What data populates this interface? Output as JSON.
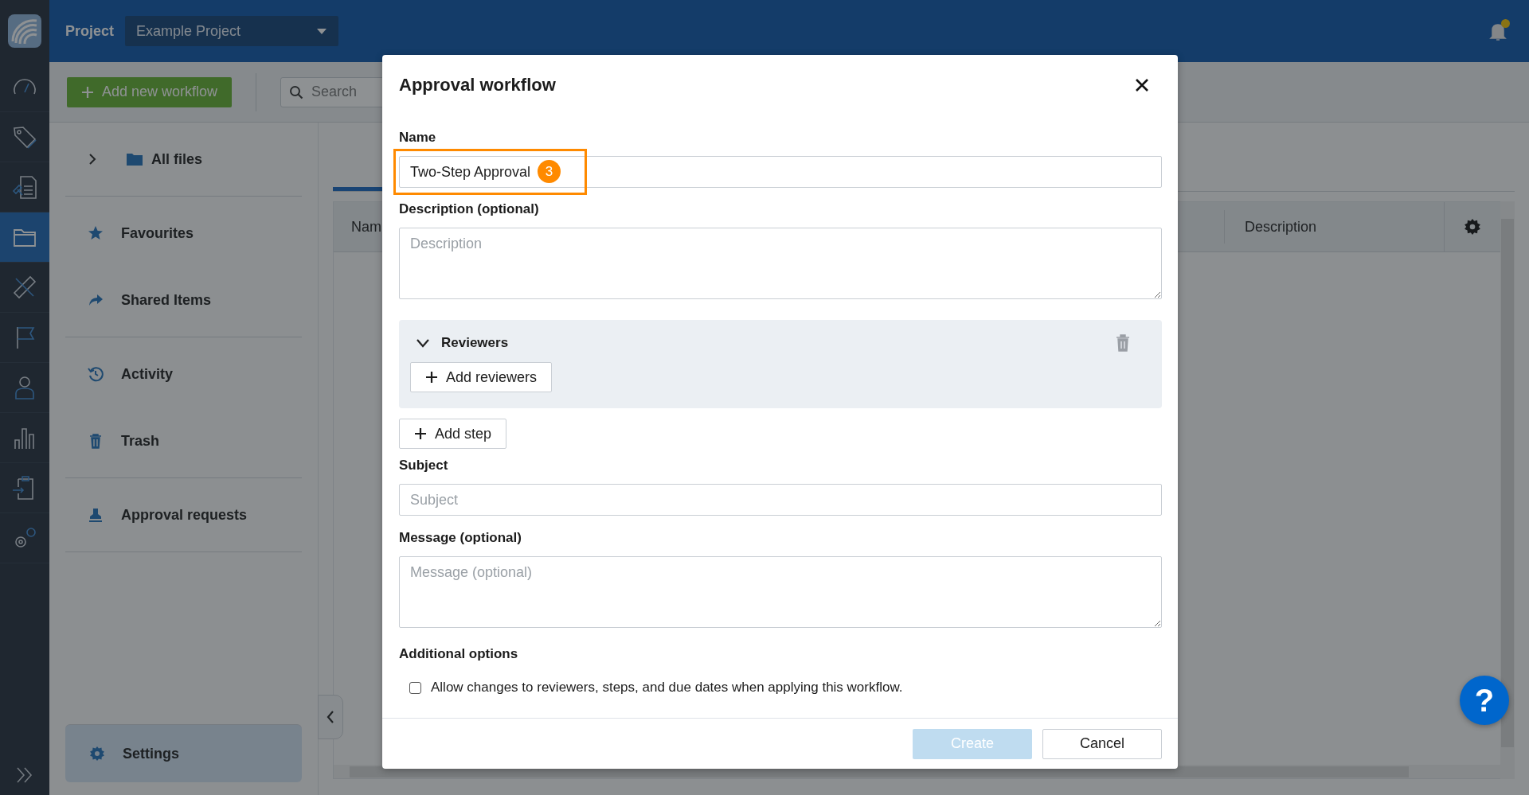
{
  "top_bar": {
    "project_label": "Project",
    "project_select": "Example Project",
    "notifications": {
      "unread": true
    }
  },
  "rail": [
    {
      "selected": false
    },
    {
      "selected": false
    },
    {
      "selected": false
    },
    {
      "selected": true
    },
    {
      "selected": false
    },
    {
      "selected": false
    },
    {
      "selected": false
    },
    {
      "selected": false
    },
    {
      "selected": false
    },
    {
      "selected": false
    }
  ],
  "toolbar": {
    "add_button": "Add new workflow",
    "search": {
      "placeholder": "Search"
    }
  },
  "nav": [
    [
      {
        "label": "All files",
        "expanded": false
      }
    ],
    [
      {
        "label": "Favourites"
      },
      {
        "label": "Shared Items"
      }
    ],
    [
      {
        "label": "Activity"
      },
      {
        "label": "Trash"
      }
    ],
    [
      {
        "label": "Approval requests"
      }
    ]
  ],
  "settings": {
    "label": "Settings",
    "selected": true
  },
  "table": {
    "columns": [
      "Nam",
      "Description"
    ]
  },
  "dialog": {
    "title": "Approval workflow",
    "name": {
      "label": "Name",
      "value": "Two-Step Approval"
    },
    "annotation": {
      "number": "3"
    },
    "description": {
      "label": "Description (optional)",
      "placeholder": "Description"
    },
    "steps": [
      {
        "title": "Reviewers",
        "expanded": true,
        "add_button": "Add reviewers"
      }
    ],
    "add_step": "Add step",
    "subject": {
      "label": "Subject",
      "placeholder": "Subject"
    },
    "message": {
      "label": "Message (optional)",
      "placeholder": "Message (optional)"
    },
    "options_title": "Additional options",
    "options": [
      {
        "label": "Allow changes to reviewers, steps, and due dates when applying this workflow.",
        "checked": false
      }
    ],
    "buttons": [
      {
        "kind": "primary",
        "label": "Create",
        "disabled": true
      },
      {
        "kind": "secondary",
        "label": "Cancel",
        "disabled": false
      }
    ]
  },
  "help_button": "?"
}
